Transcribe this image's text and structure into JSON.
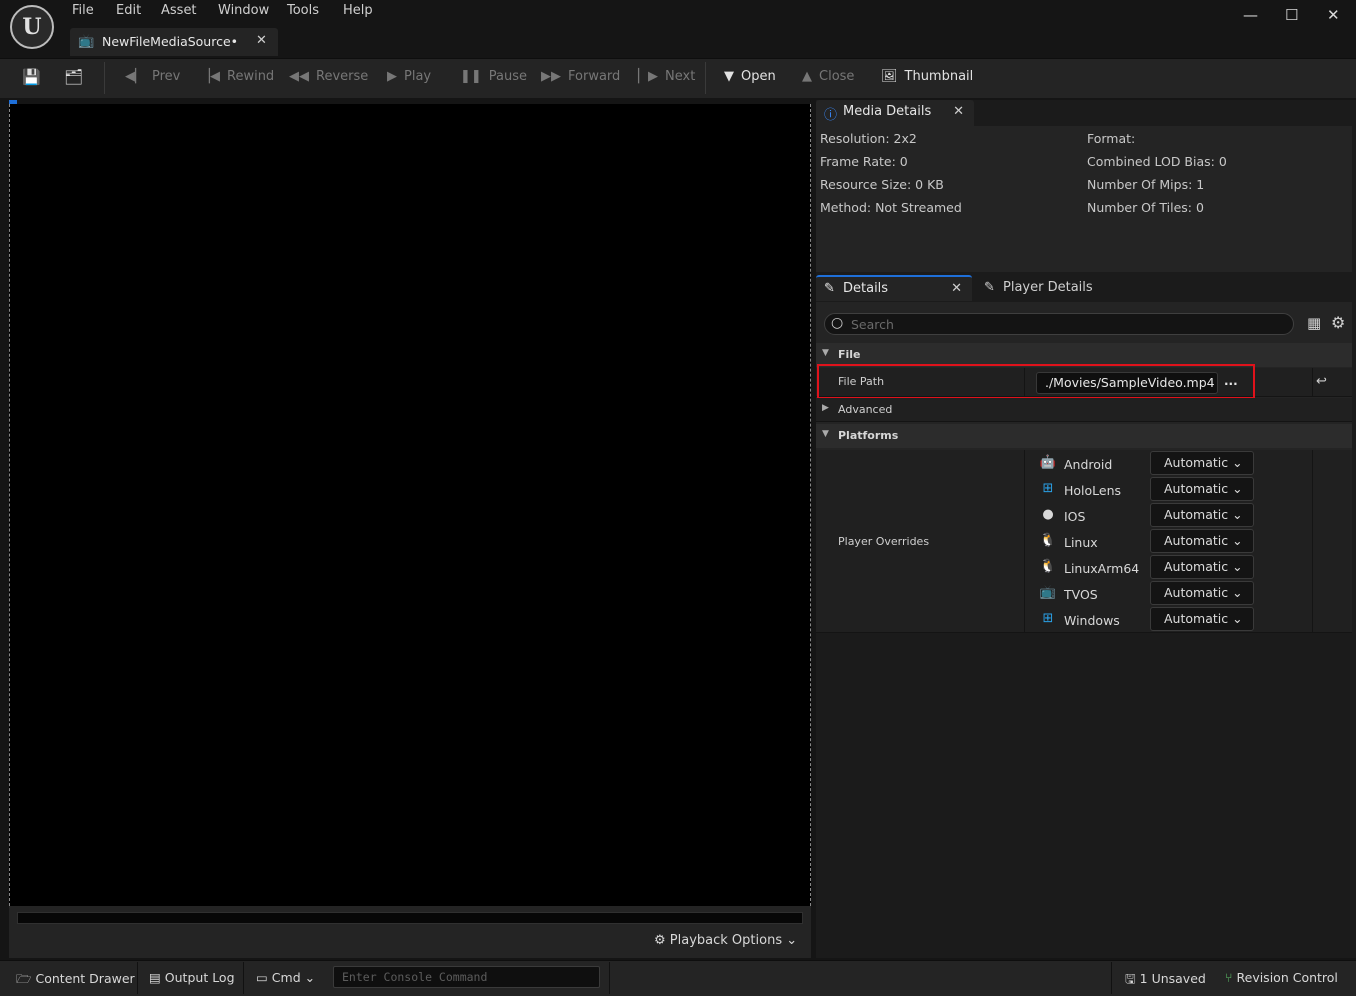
{
  "menu": [
    "File",
    "Edit",
    "Asset",
    "Window",
    "Tools",
    "Help"
  ],
  "document_tab": {
    "label": "NewFileMediaSource•"
  },
  "window_controls": {
    "minimize": "—",
    "maximize": "☐",
    "close": "✕"
  },
  "toolbar": {
    "prev": "Prev",
    "rewind": "Rewind",
    "reverse": "Reverse",
    "play": "Play",
    "pause": "Pause",
    "forward": "Forward",
    "next": "Next",
    "open": "Open",
    "close": "Close",
    "thumbnail": "Thumbnail"
  },
  "viewport": {
    "playback_options": "Playback Options"
  },
  "media_details": {
    "tab_label": "Media Details",
    "left": [
      "Resolution: 2x2",
      "Frame Rate: 0",
      "Resource Size: 0 KB",
      "Method: Not Streamed"
    ],
    "right": [
      "Format:",
      "Combined LOD Bias: 0",
      "Number Of Mips: 1",
      "Number Of Tiles: 0"
    ]
  },
  "details": {
    "tab_label": "Details",
    "player_tab_label": "Player Details",
    "search_placeholder": "Search",
    "file_section": "File",
    "file_path_label": "File Path",
    "file_path_value": "./Movies/SampleVideo.mp4",
    "browse_label": "...",
    "advanced_section": "Advanced",
    "platforms_section": "Platforms",
    "player_overrides_label": "Player Overrides",
    "platforms": [
      {
        "name": "Android",
        "value": "Automatic",
        "icon": "android-icon"
      },
      {
        "name": "HoloLens",
        "value": "Automatic",
        "icon": "hololens-icon"
      },
      {
        "name": "IOS",
        "value": "Automatic",
        "icon": "apple-icon"
      },
      {
        "name": "Linux",
        "value": "Automatic",
        "icon": "linux-icon"
      },
      {
        "name": "LinuxArm64",
        "value": "Automatic",
        "icon": "linux-icon"
      },
      {
        "name": "TVOS",
        "value": "Automatic",
        "icon": "tvos-icon"
      },
      {
        "name": "Windows",
        "value": "Automatic",
        "icon": "windows-icon"
      }
    ]
  },
  "statusbar": {
    "content_drawer": "Content Drawer",
    "output_log": "Output Log",
    "cmd": "Cmd",
    "console_placeholder": "Enter Console Command",
    "unsaved": "1 Unsaved",
    "revision_control": "Revision Control"
  },
  "colors": {
    "highlight": "#e0121b",
    "accent": "#1e6fd9",
    "background": "#151515",
    "panel": "#242424"
  }
}
